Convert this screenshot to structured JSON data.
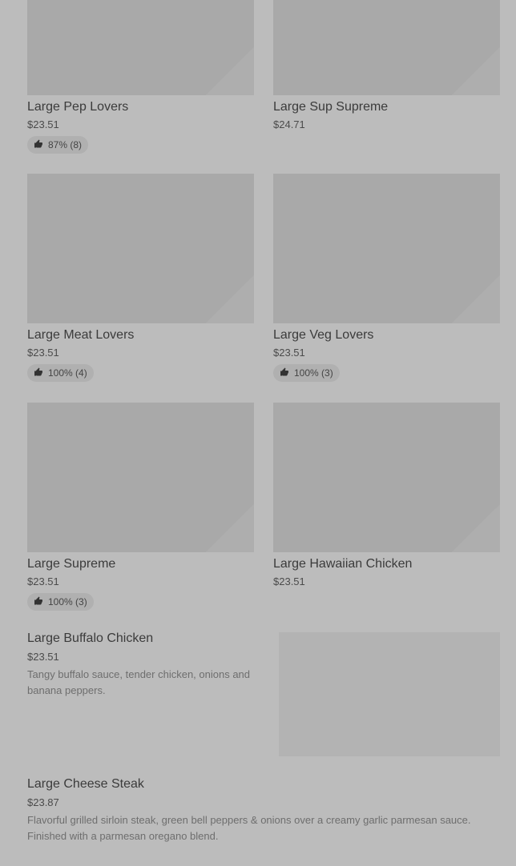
{
  "grid": [
    {
      "name": "Large Pep Lovers",
      "price": "$23.51",
      "rating": "87% (8)"
    },
    {
      "name": "Large Sup Supreme",
      "price": "$24.71",
      "rating": null
    },
    {
      "name": "Large Meat Lovers",
      "price": "$23.51",
      "rating": "100% (4)"
    },
    {
      "name": "Large Veg Lovers",
      "price": "$23.51",
      "rating": "100% (3)"
    },
    {
      "name": "Large Supreme",
      "price": "$23.51",
      "rating": "100% (3)"
    },
    {
      "name": "Large Hawaiian Chicken",
      "price": "$23.51",
      "rating": null
    }
  ],
  "list": [
    {
      "name": "Large Buffalo Chicken",
      "price": "$23.51",
      "description": "Tangy buffalo sauce, tender chicken, onions and banana peppers."
    },
    {
      "name": "Large Cheese Steak",
      "price": "$23.87",
      "description": "Flavorful grilled sirloin steak, green bell peppers & onions over a creamy garlic parmesan sauce. Finished with a parmesan oregano blend."
    }
  ],
  "icons": {
    "rating": "thumbs-up-icon"
  },
  "colors": {
    "background": "#bcbcbc",
    "image_placeholder": "#a9a9a9",
    "badge": "#b0b0b0"
  }
}
